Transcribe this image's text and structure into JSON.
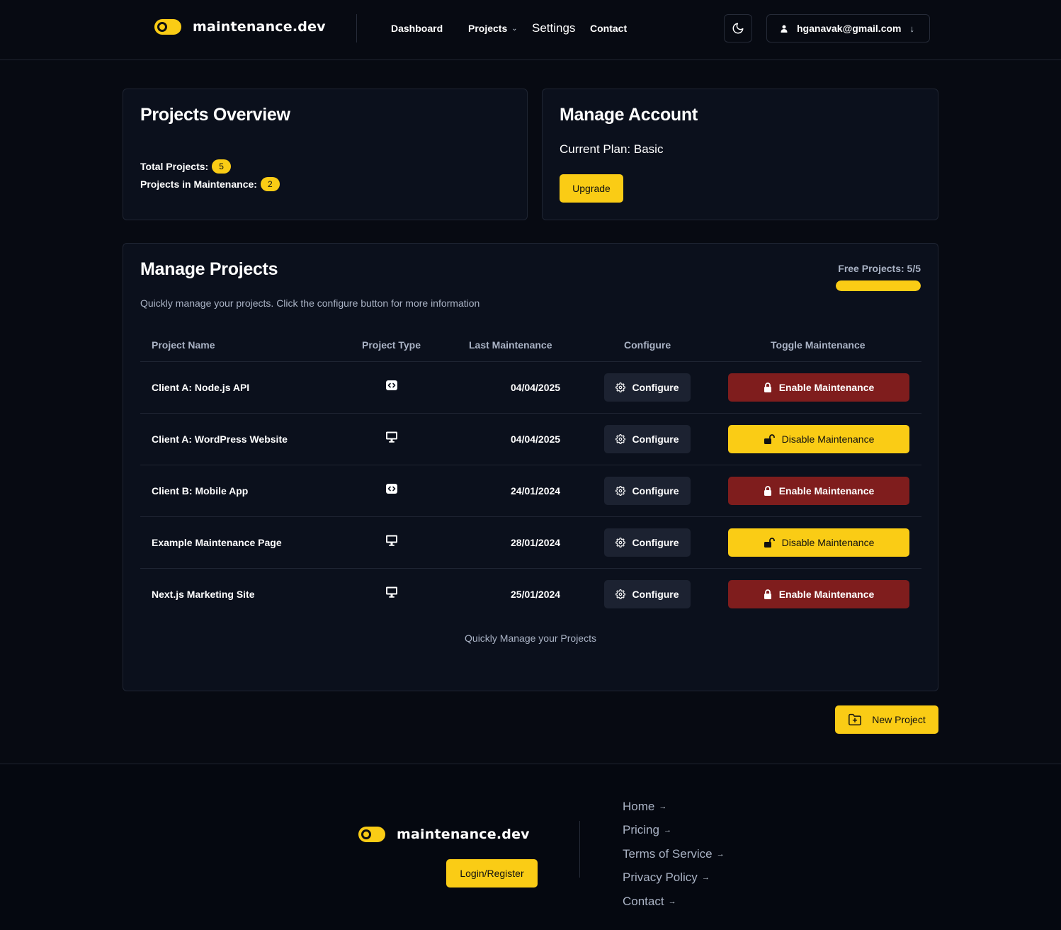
{
  "header": {
    "brand": "maintenance.dev",
    "nav": {
      "dashboard": "Dashboard",
      "projects": "Projects",
      "settings": "Settings",
      "contact": "Contact"
    },
    "user_email": "hganavak@gmail.com"
  },
  "overview": {
    "title": "Projects Overview",
    "total_label": "Total Projects:",
    "total_value": "5",
    "maintenance_label": "Projects in Maintenance:",
    "maintenance_value": "2"
  },
  "account": {
    "title": "Manage Account",
    "plan": "Current Plan: Basic",
    "upgrade_label": "Upgrade"
  },
  "manage": {
    "title": "Manage Projects",
    "subtitle": "Quickly manage your projects. Click the configure button for more information",
    "free_label": "Free Projects: 5/5",
    "free_progress": 1.0,
    "columns": {
      "name": "Project Name",
      "type": "Project Type",
      "last": "Last Maintenance",
      "configure": "Configure",
      "toggle": "Toggle Maintenance"
    },
    "rows": [
      {
        "name": "Client A: Node.js API",
        "type_icon": "code-icon",
        "date": "04/04/2025",
        "configure": "Configure",
        "toggle": "Enable Maintenance",
        "toggle_state": "enable"
      },
      {
        "name": "Client A: WordPress Website",
        "type_icon": "monitor-icon",
        "date": "04/04/2025",
        "configure": "Configure",
        "toggle": "Disable Maintenance",
        "toggle_state": "disable"
      },
      {
        "name": "Client B: Mobile App",
        "type_icon": "code-icon",
        "date": "24/01/2024",
        "configure": "Configure",
        "toggle": "Enable Maintenance",
        "toggle_state": "enable"
      },
      {
        "name": "Example Maintenance Page",
        "type_icon": "monitor-icon",
        "date": "28/01/2024",
        "configure": "Configure",
        "toggle": "Disable Maintenance",
        "toggle_state": "disable"
      },
      {
        "name": "Next.js Marketing Site",
        "type_icon": "monitor-icon",
        "date": "25/01/2024",
        "configure": "Configure",
        "toggle": "Enable Maintenance",
        "toggle_state": "enable"
      }
    ],
    "footnote": "Quickly Manage your Projects"
  },
  "new_project_label": "New Project",
  "footer": {
    "brand": "maintenance.dev",
    "login_label": "Login/Register",
    "links": [
      "Home",
      "Pricing",
      "Terms of Service",
      "Privacy Policy",
      "Contact"
    ]
  },
  "colors": {
    "accent": "#facc15",
    "danger": "#7f1d1d",
    "background": "#070a12",
    "card": "#0b101c"
  }
}
